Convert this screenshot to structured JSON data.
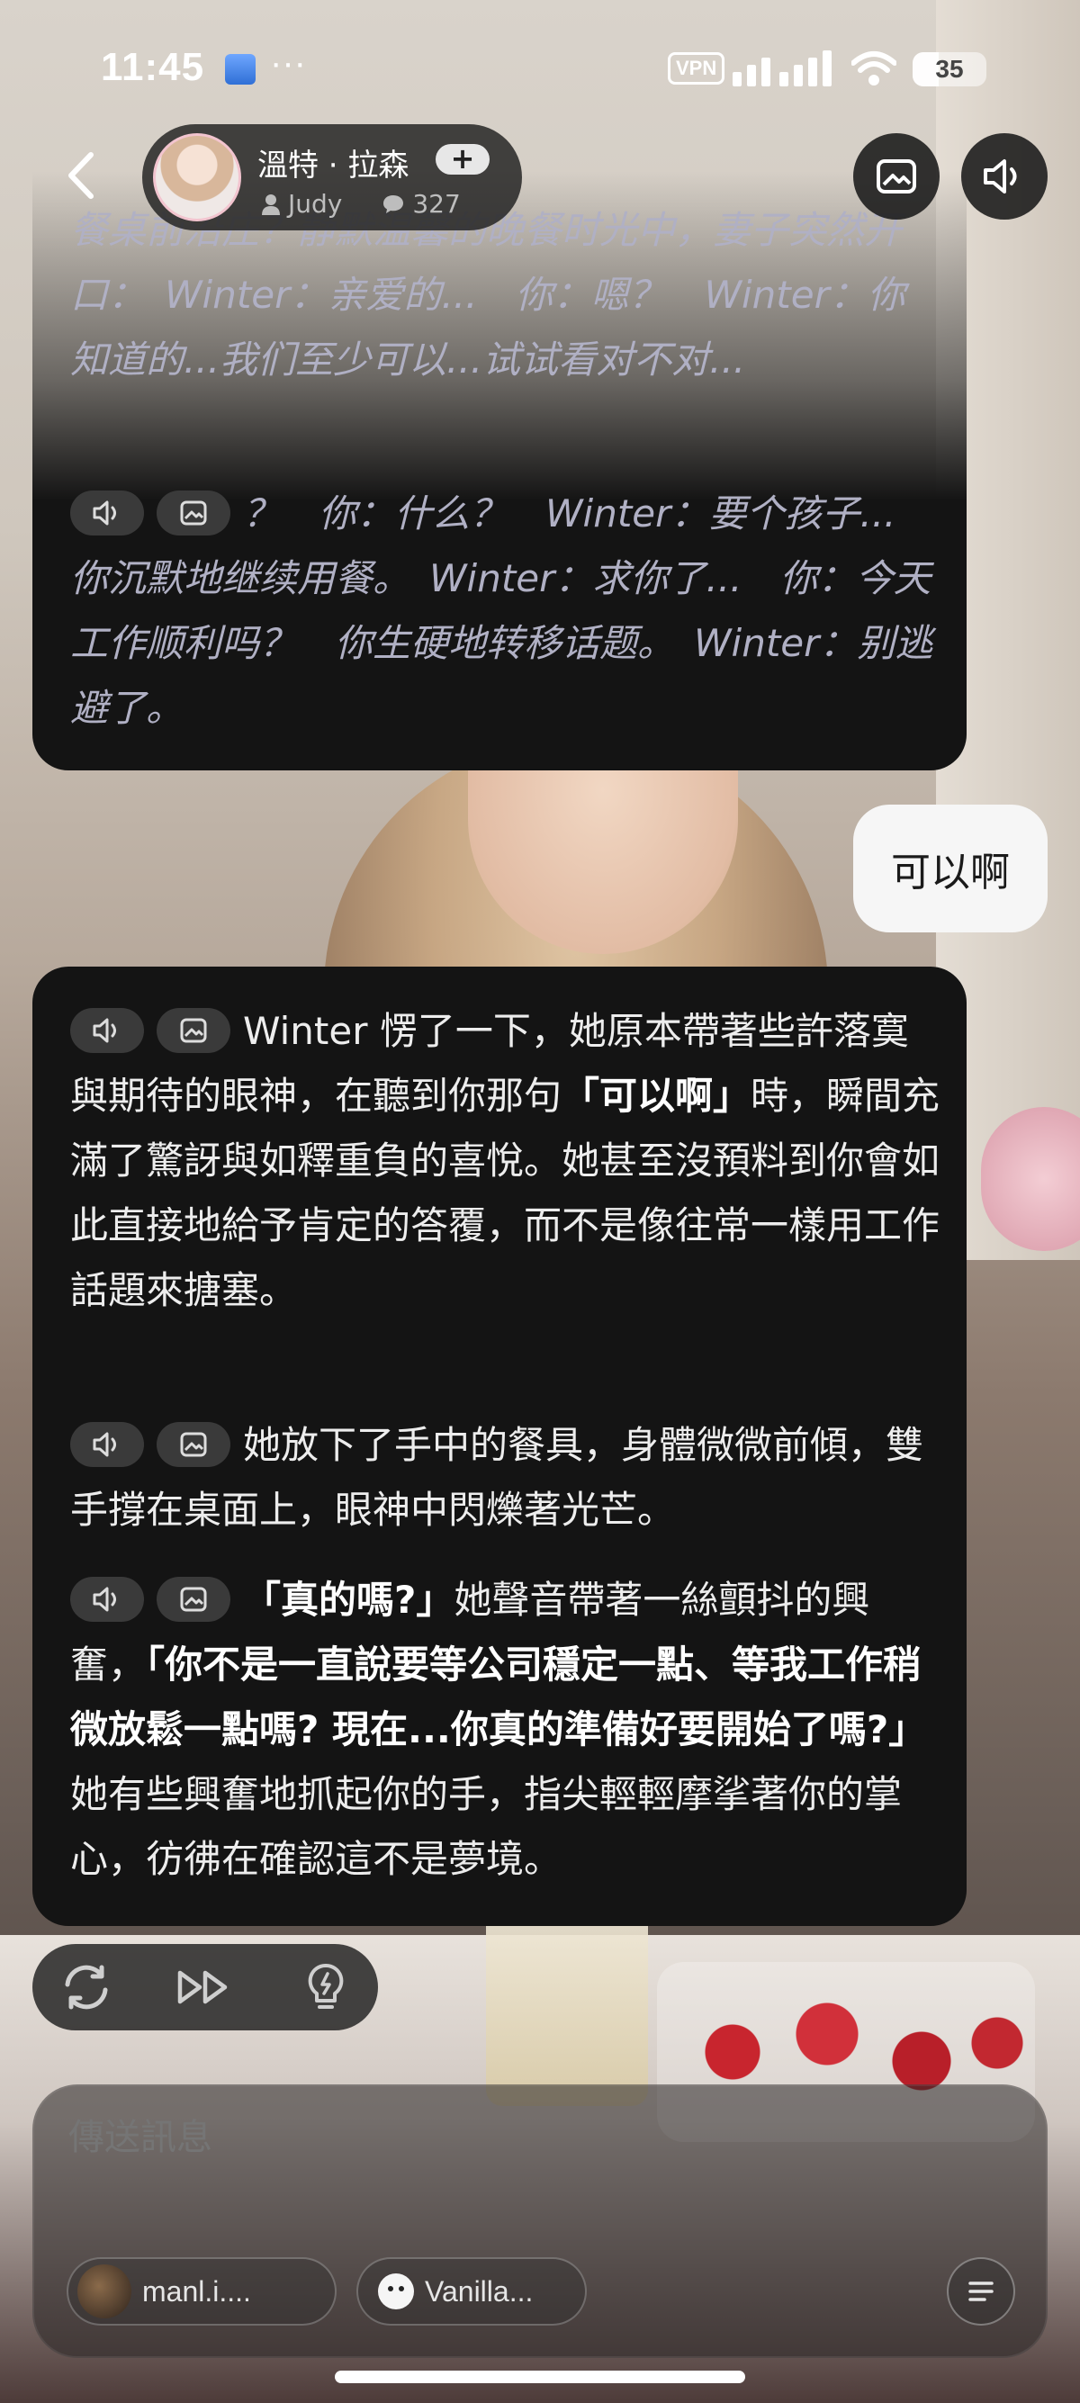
{
  "status_bar": {
    "time": "11:45",
    "dots": "···",
    "vpn": "VPN",
    "battery": "35",
    "battery_level": 0.35
  },
  "header": {
    "character_name": "溫特 · 拉森",
    "plus": "+",
    "creator": "Judy",
    "chat_count": "327"
  },
  "messages": {
    "top_faded": "餐桌前沿庄？静默温馨的晚餐时光中，妻子突然开口：　Winter：亲爱的...　你：嗯？　Winter：你知道的...我们至少可以...试试看对不对...",
    "top_bottom": "？　你：什么？　Winter：要个孩子...　你沉默地继续用餐。　Winter：求你了...　你：今天工作顺利吗？　你生硬地转移话题。　Winter：别逃避了。",
    "user_reply": "可以啊",
    "main_p1_a": "Winter 愣了一下，她原本帶著些許落寞與期待的眼神，在聽到你那句",
    "main_p1_b": "「可以啊」",
    "main_p1_c": "時，瞬間充滿了驚訝與如釋重負的喜悅。她甚至沒預料到你會如此直接地給予肯定的答覆，而不是像往常一樣用工作話題來搪塞。",
    "main_p2": "她放下了手中的餐具，身體微微前傾，雙手撐在桌面上，眼神中閃爍著光芒。",
    "main_p3_a": "「真的嗎?」",
    "main_p3_b": "她聲音帶著一絲顫抖的興奮，",
    "main_p3_c": "「你不是一直說要等公司穩定一點、等我工作稍微放鬆一點嗎? 現在...你真的準備好要開始了嗎?」",
    "main_p3_d": " 她有些興奮地抓起你的手，指尖輕輕摩挲著你的掌心，彷彿在確認這不是夢境。"
  },
  "composer": {
    "placeholder": "傳送訊息",
    "shortcut_1": "manl.i....",
    "shortcut_2": "Vanilla..."
  },
  "icons": {
    "back": "back-arrow-icon",
    "image": "image-icon",
    "speaker": "speaker-icon",
    "regenerate": "regenerate-icon",
    "continue": "fast-forward-icon",
    "hint": "lightbulb-icon",
    "menu": "menu-icon"
  }
}
